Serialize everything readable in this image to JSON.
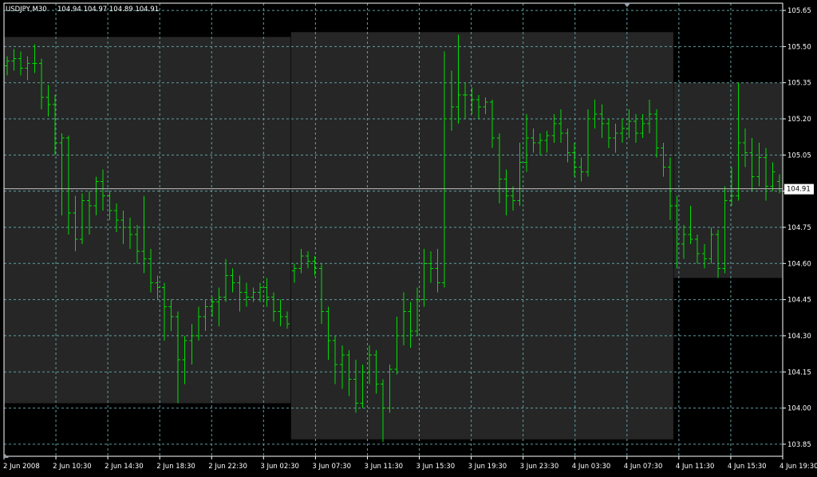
{
  "colors": {
    "background": "#000000",
    "plot_border": "#ffffff",
    "grid": "#5f9ea0",
    "bar": "#00dd00",
    "session_box": "#262626",
    "text": "#ffffff",
    "current_price_bg": "#ffffff",
    "current_price_text": "#000000"
  },
  "header": {
    "symbol": "USDJPY,M30",
    "ohlc": "104.94 104.97 104.89 104.91"
  },
  "current_price_label": "104.91",
  "chart_data": {
    "type": "bar",
    "subtype": "ohlc",
    "symbol": "USDJPY",
    "timeframe": "M30",
    "title": "USDJPY,M30",
    "ylim": [
      103.8,
      105.68
    ],
    "y_ticks": [
      "105.65",
      "105.50",
      "105.35",
      "105.20",
      "105.05",
      "104.90",
      "104.75",
      "104.60",
      "104.45",
      "104.30",
      "104.15",
      "104.00",
      "103.85"
    ],
    "x_tick_labels": [
      "2 Jun 2008",
      "2 Jun 10:30",
      "2 Jun 14:30",
      "2 Jun 18:30",
      "2 Jun 22:30",
      "3 Jun 02:30",
      "3 Jun 07:30",
      "3 Jun 11:30",
      "3 Jun 15:30",
      "3 Jun 19:30",
      "3 Jun 23:30",
      "4 Jun 03:30",
      "4 Jun 07:30",
      "4 Jun 11:30",
      "4 Jun 15:30",
      "4 Jun 19:30"
    ],
    "grid": true,
    "current_price": 104.91,
    "last_bar": {
      "open": 104.94,
      "high": 104.97,
      "low": 104.89,
      "close": 104.91
    },
    "session_ranges": [
      {
        "high": 105.54,
        "low": 104.02
      },
      {
        "high": 105.56,
        "low": 103.87
      },
      {
        "high": 105.35,
        "low": 104.54
      }
    ],
    "bars": [
      [
        105.42,
        105.46,
        105.38,
        105.44
      ],
      [
        105.44,
        105.49,
        105.4,
        105.45
      ],
      [
        105.45,
        105.48,
        105.38,
        105.41
      ],
      [
        105.41,
        105.46,
        105.36,
        105.43
      ],
      [
        105.43,
        105.51,
        105.39,
        105.43
      ],
      [
        105.43,
        105.45,
        105.24,
        105.29
      ],
      [
        105.29,
        105.34,
        105.21,
        105.26
      ],
      [
        105.26,
        105.3,
        105.05,
        105.1
      ],
      [
        105.1,
        105.14,
        104.8,
        105.12
      ],
      [
        105.12,
        105.13,
        104.72,
        104.81
      ],
      [
        104.81,
        104.88,
        104.65,
        104.7
      ],
      [
        104.7,
        104.89,
        104.68,
        104.86
      ],
      [
        104.86,
        104.9,
        104.72,
        104.84
      ],
      [
        104.84,
        104.96,
        104.8,
        104.94
      ],
      [
        104.94,
        104.99,
        104.82,
        104.88
      ],
      [
        104.88,
        104.9,
        104.78,
        104.82
      ],
      [
        104.82,
        104.85,
        104.73,
        104.78
      ],
      [
        104.78,
        104.82,
        104.68,
        104.75
      ],
      [
        104.75,
        104.79,
        104.66,
        104.72
      ],
      [
        104.72,
        104.76,
        104.6,
        104.65
      ],
      [
        104.65,
        104.88,
        104.56,
        104.62
      ],
      [
        104.62,
        104.66,
        104.48,
        104.52
      ],
      [
        104.52,
        104.55,
        104.45,
        104.5
      ],
      [
        104.5,
        104.52,
        104.28,
        104.42
      ],
      [
        104.42,
        104.45,
        104.32,
        104.38
      ],
      [
        104.38,
        104.4,
        104.02,
        104.2
      ],
      [
        104.2,
        104.3,
        104.1,
        104.28
      ],
      [
        104.28,
        104.35,
        104.18,
        104.3
      ],
      [
        104.3,
        104.42,
        104.28,
        104.38
      ],
      [
        104.38,
        104.45,
        104.32,
        104.42
      ],
      [
        104.42,
        104.46,
        104.38,
        104.44
      ],
      [
        104.44,
        104.5,
        104.34,
        104.46
      ],
      [
        104.46,
        104.62,
        104.44,
        104.55
      ],
      [
        104.55,
        104.58,
        104.48,
        104.52
      ],
      [
        104.52,
        104.55,
        104.4,
        104.48
      ],
      [
        104.48,
        104.52,
        104.42,
        104.46
      ],
      [
        104.46,
        104.5,
        104.44,
        104.48
      ],
      [
        104.48,
        104.52,
        104.44,
        104.5
      ],
      [
        104.5,
        104.54,
        104.42,
        104.46
      ],
      [
        104.46,
        104.48,
        104.36,
        104.4
      ],
      [
        104.4,
        104.45,
        104.34,
        104.38
      ],
      [
        104.38,
        104.4,
        104.33,
        104.35
      ],
      [
        104.57,
        104.6,
        104.52,
        104.58
      ],
      [
        104.58,
        104.66,
        104.56,
        104.63
      ],
      [
        104.63,
        104.65,
        104.58,
        104.61
      ],
      [
        104.61,
        104.63,
        104.55,
        104.58
      ],
      [
        104.58,
        104.6,
        104.35,
        104.4
      ],
      [
        104.4,
        104.42,
        104.2,
        104.28
      ],
      [
        104.28,
        104.3,
        104.1,
        104.18
      ],
      [
        104.18,
        104.26,
        104.08,
        104.22
      ],
      [
        104.22,
        104.24,
        104.05,
        104.12
      ],
      [
        104.12,
        104.2,
        103.98,
        104.02
      ],
      [
        104.02,
        104.18,
        104.0,
        104.15
      ],
      [
        104.15,
        104.26,
        104.1,
        104.22
      ],
      [
        104.22,
        104.24,
        104.06,
        104.1
      ],
      [
        104.1,
        104.12,
        103.86,
        104.0
      ],
      [
        104.0,
        104.18,
        103.98,
        104.16
      ],
      [
        104.16,
        104.38,
        104.14,
        104.3
      ],
      [
        104.3,
        104.48,
        104.26,
        104.4
      ],
      [
        104.4,
        104.44,
        104.25,
        104.32
      ],
      [
        104.32,
        104.5,
        104.3,
        104.45
      ],
      [
        104.45,
        104.66,
        104.42,
        104.6
      ],
      [
        104.6,
        104.65,
        104.52,
        104.58
      ],
      [
        104.58,
        104.66,
        104.48,
        104.52
      ],
      [
        104.52,
        105.48,
        104.5,
        105.2
      ],
      [
        105.2,
        105.4,
        105.15,
        105.25
      ],
      [
        105.25,
        105.55,
        105.18,
        105.3
      ],
      [
        105.3,
        105.35,
        105.2,
        105.3
      ],
      [
        105.3,
        105.33,
        105.22,
        105.28
      ],
      [
        105.28,
        105.3,
        105.2,
        105.25
      ],
      [
        105.25,
        105.29,
        105.22,
        105.27
      ],
      [
        105.27,
        105.28,
        105.08,
        105.12
      ],
      [
        105.12,
        105.14,
        104.85,
        104.95
      ],
      [
        104.95,
        104.99,
        104.8,
        104.88
      ],
      [
        104.88,
        104.92,
        104.82,
        104.86
      ],
      [
        104.86,
        105.1,
        104.84,
        105.02
      ],
      [
        105.02,
        105.22,
        104.98,
        105.12
      ],
      [
        105.12,
        105.16,
        105.06,
        105.1
      ],
      [
        105.1,
        105.14,
        105.05,
        105.11
      ],
      [
        105.11,
        105.15,
        105.06,
        105.13
      ],
      [
        105.13,
        105.22,
        105.1,
        105.18
      ],
      [
        105.18,
        105.24,
        105.1,
        105.14
      ],
      [
        105.14,
        105.16,
        105.02,
        105.06
      ],
      [
        105.06,
        105.1,
        104.96,
        105.0
      ],
      [
        105.0,
        105.04,
        104.94,
        104.98
      ],
      [
        104.98,
        105.24,
        104.96,
        105.2
      ],
      [
        105.2,
        105.28,
        105.16,
        105.22
      ],
      [
        105.22,
        105.26,
        105.12,
        105.18
      ],
      [
        105.18,
        105.2,
        105.08,
        105.12
      ],
      [
        105.12,
        105.18,
        105.06,
        105.14
      ],
      [
        105.14,
        105.2,
        105.1,
        105.16
      ],
      [
        105.16,
        105.24,
        105.12,
        105.19
      ],
      [
        105.19,
        105.22,
        105.1,
        105.14
      ],
      [
        105.14,
        105.22,
        105.12,
        105.18
      ],
      [
        105.18,
        105.28,
        105.14,
        105.22
      ],
      [
        105.22,
        105.24,
        105.04,
        105.08
      ],
      [
        105.08,
        105.1,
        104.96,
        105.0
      ],
      [
        105.0,
        105.04,
        104.78,
        104.84
      ],
      [
        104.84,
        104.88,
        104.58,
        104.68
      ],
      [
        104.68,
        104.76,
        104.62,
        104.72
      ],
      [
        104.72,
        104.84,
        104.68,
        104.7
      ],
      [
        104.7,
        104.72,
        104.6,
        104.64
      ],
      [
        104.64,
        104.68,
        104.58,
        104.62
      ],
      [
        104.62,
        104.75,
        104.6,
        104.72
      ],
      [
        104.72,
        104.74,
        104.54,
        104.58
      ],
      [
        104.58,
        104.92,
        104.56,
        104.86
      ],
      [
        104.86,
        105.0,
        104.84,
        104.88
      ],
      [
        104.88,
        105.35,
        104.86,
        105.1
      ],
      [
        105.1,
        105.16,
        105.0,
        105.06
      ],
      [
        105.06,
        105.12,
        104.9,
        104.96
      ],
      [
        104.96,
        105.1,
        104.92,
        105.04
      ],
      [
        105.04,
        105.08,
        104.86,
        104.92
      ],
      [
        104.92,
        105.02,
        104.9,
        104.98
      ],
      [
        104.94,
        104.97,
        104.89,
        104.91
      ]
    ]
  }
}
